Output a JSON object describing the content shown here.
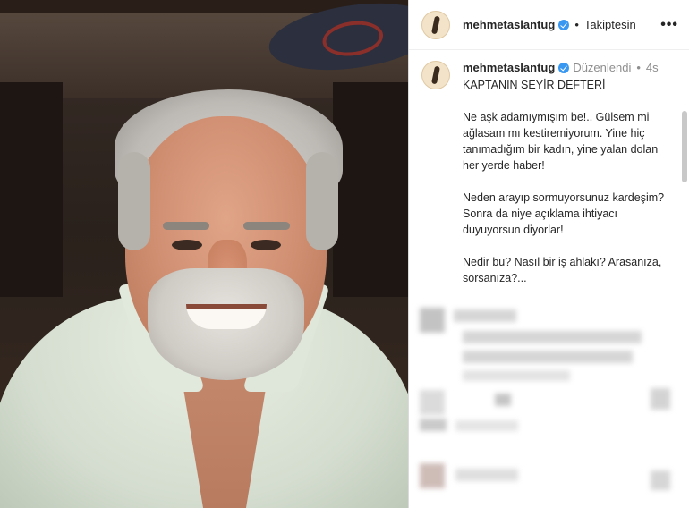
{
  "post": {
    "username": "mehmetaslantug",
    "follow_status": "Takiptesin",
    "more_label": "•••",
    "separator": "•"
  },
  "caption": {
    "username": "mehmetaslantug",
    "edited_label": "Düzenlendi",
    "separator": "•",
    "time": "4s",
    "title": "KAPTANIN SEYİR DEFTERİ",
    "paragraphs": [
      "Ne aşk adamıymışım be!.. Gülsem mi ağlasam mı kestiremiyorum. Yine hiç tanımadığım bir kadın, yine yalan dolan her yerde haber!",
      "Neden arayıp sormuyorsunuz kardeşim? Sonra da niye açıklama ihtiyacı duyuyorsun diyorlar!",
      "Nedir bu? Nasıl bir iş ahlakı? Arasanıza, sorsanıza?..."
    ]
  },
  "colors": {
    "verified": "#3897f0",
    "text": "#262626",
    "muted": "#8e8e8e"
  },
  "icons": {
    "verified": "verified-badge-icon",
    "more": "more-options-icon"
  }
}
